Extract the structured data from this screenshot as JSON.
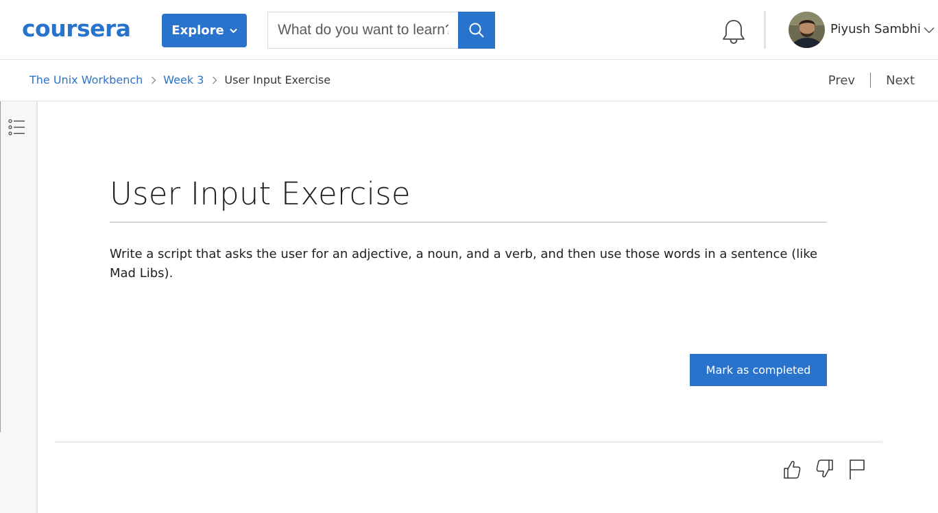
{
  "colors": {
    "brand": "#2a73cc",
    "divider": "#e1e1e1"
  },
  "header": {
    "logo_text": "coursera",
    "explore_label": "Explore",
    "search": {
      "placeholder": "What do you want to learn?",
      "value": ""
    },
    "user": {
      "name": "Piyush Sambhi"
    },
    "icons": [
      "search-icon",
      "bell-icon",
      "chevron-down-icon"
    ]
  },
  "breadcrumb": {
    "items": [
      {
        "label": "The Unix Workbench"
      },
      {
        "label": "Week 3"
      },
      {
        "label": "User Input Exercise"
      }
    ],
    "prev_label": "Prev",
    "next_label": "Next"
  },
  "main": {
    "title": "User Input Exercise",
    "body": "Write a script that asks the user for an adjective, a noun, and a verb, and then use those words in a sentence (like Mad Libs).",
    "complete_label": "Mark as completed"
  },
  "feedback": {
    "icons": [
      "thumbs-up-icon",
      "thumbs-down-icon",
      "flag-icon"
    ]
  }
}
